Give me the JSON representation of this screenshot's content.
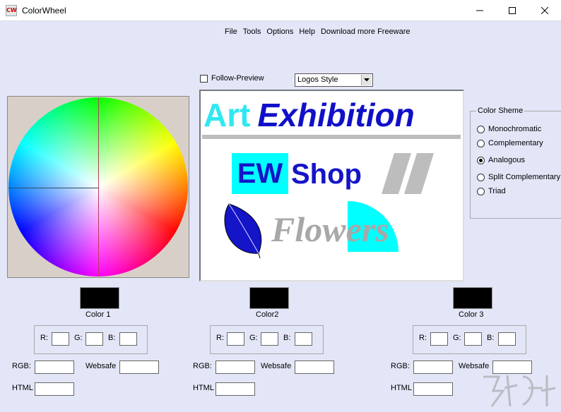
{
  "window": {
    "title": "ColorWheel",
    "icon_text": "CW"
  },
  "menu": [
    "File",
    "Tools",
    "Options",
    "Help",
    "Download more Freeware"
  ],
  "follow_preview": {
    "label": "Follow-Preview",
    "checked": false
  },
  "style_combo": {
    "value": "Logos Style"
  },
  "preview": {
    "art": "Art",
    "exhibition": "Exhibition",
    "ew": "EW",
    "shop": "Shop",
    "flowers": "Flowers"
  },
  "scheme": {
    "title": "Color Sheme",
    "options": [
      "Monochromatic",
      "Complementary",
      "Analogous",
      "Split Complementary",
      "Triad"
    ],
    "selected": "Analogous"
  },
  "colors": [
    {
      "label": "Color 1",
      "r": "R:",
      "g": "G:",
      "b": "B:",
      "rgb": "RGB:",
      "websafe": "Websafe",
      "html": "HTML"
    },
    {
      "label": "Color2",
      "r": "R:",
      "g": "G:",
      "b": "B:",
      "rgb": "RGB:",
      "websafe": "Websafe",
      "html": "HTML"
    },
    {
      "label": "Color 3",
      "r": "R:",
      "g": "G:",
      "b": "B:",
      "rgb": "RGB:",
      "websafe": "Websafe",
      "html": "HTML"
    }
  ],
  "palette": {
    "background": "#e3e6f7",
    "preview_cyan": "#00ffff",
    "preview_blue": "#1414c8",
    "preview_gray": "#a8a8a8",
    "swatch_color": "#000000"
  }
}
